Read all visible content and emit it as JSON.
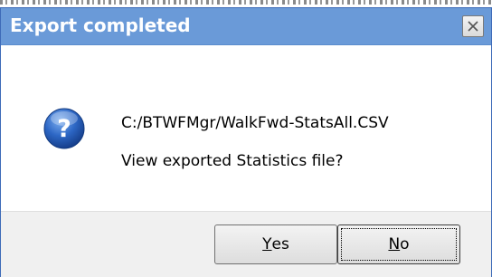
{
  "dialog": {
    "title": "Export completed",
    "file_path": "C:/BTWFMgr/WalkFwd-StatsAll.CSV",
    "message": "View exported Statistics file?",
    "icon": "question-icon"
  },
  "buttons": {
    "yes": {
      "mnemonic": "Y",
      "rest": "es"
    },
    "no": {
      "mnemonic": "N",
      "rest": "o"
    }
  },
  "colors": {
    "titlebar": "#6a9ad8",
    "title_text": "#ffffff",
    "icon_blue": "#1f56b3"
  }
}
